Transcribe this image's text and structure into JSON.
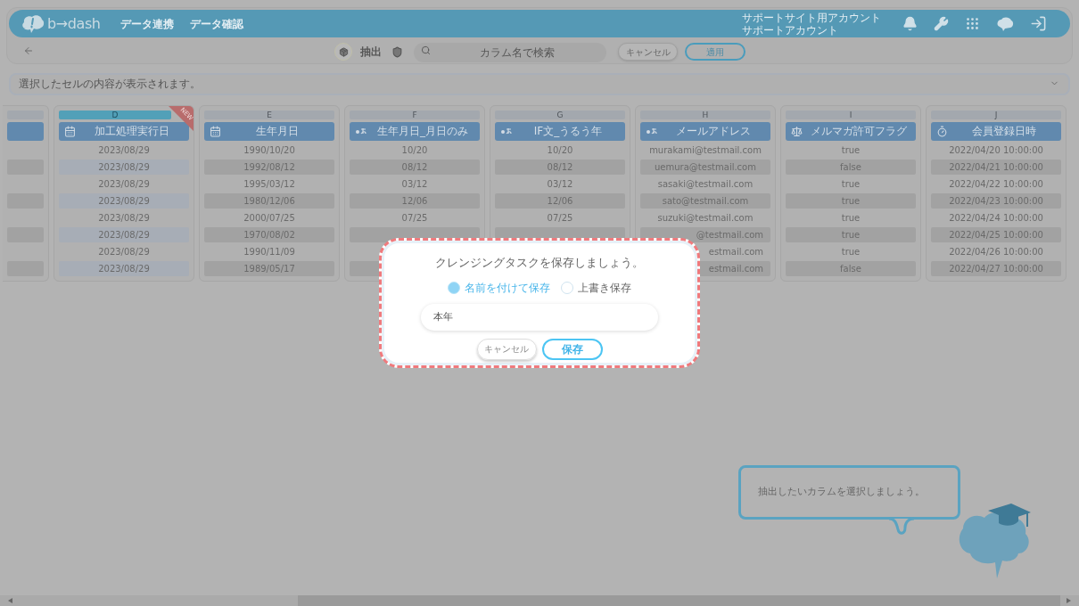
{
  "header": {
    "logo": "b→dash",
    "nav": [
      "データ連携",
      "データ確認"
    ],
    "account": [
      "サポートサイト用アカウント",
      "サポートアカウント"
    ]
  },
  "toolbar": {
    "title": "抽出",
    "search": {
      "placeholder": "カラム名で検索"
    },
    "buttons": [
      {
        "label": "キャンセル",
        "kind": "secondary"
      },
      {
        "label": "適用",
        "kind": "primary"
      }
    ]
  },
  "cell_viewer": {
    "placeholder": "選択したセルの内容が表示されます。"
  },
  "columns": [
    {
      "kind": "none",
      "selected": false,
      "cells": [
        null,
        null,
        null,
        null,
        null,
        null,
        null,
        null
      ]
    },
    {
      "letter": "D",
      "title": "加工処理実行日",
      "kind": "date",
      "selected": true,
      "badge": "NEW",
      "cells": [
        "2023/08/29",
        "2023/08/29",
        "2023/08/29",
        "2023/08/29",
        "2023/08/29",
        "2023/08/29",
        "2023/08/29",
        "2023/08/29"
      ]
    },
    {
      "letter": "E",
      "title": "生年月日",
      "kind": "date",
      "selected": false,
      "cells": [
        "1990/10/20",
        "1992/08/12",
        "1995/03/12",
        "1980/12/06",
        "2000/07/25",
        "1970/08/02",
        "1990/11/09",
        "1989/05/17"
      ]
    },
    {
      "letter": "F",
      "title": "生年月日_月日のみ",
      "kind": "text",
      "selected": false,
      "cells": [
        "10/20",
        "08/12",
        "03/12",
        "12/06",
        "07/25",
        null,
        null,
        null
      ]
    },
    {
      "letter": "G",
      "title": "IF文_うるう年",
      "kind": "text",
      "selected": false,
      "cells": [
        "10/20",
        "08/12",
        "03/12",
        "12/06",
        "07/25",
        null,
        null
      ]
    },
    {
      "letter": "H",
      "title": "メールアドレス",
      "kind": "text",
      "selected": false,
      "cells": [
        "murakami@testmail.com",
        "uemura@testmail.com",
        "sasaki@testmail.com",
        "sato@testmail.com",
        "suzuki@testmail.com",
        {
          "text": "@testmail.com",
          "clipped": true
        },
        {
          "text": "estmail.com",
          "clipped": true
        },
        {
          "text": "estmail.com",
          "clipped": true
        }
      ]
    },
    {
      "letter": "I",
      "title": "メルマガ許可フラグ",
      "kind": "bool",
      "selected": false,
      "cells": [
        "true",
        "false",
        "true",
        "true",
        "true",
        "true",
        "true",
        "false"
      ]
    },
    {
      "letter": "J",
      "title": "会員登録日時",
      "kind": "datetime",
      "selected": false,
      "cells": [
        "2022/04/20 10:00:00",
        "2022/04/21 10:00:00",
        "2022/04/22 10:00:00",
        "2022/04/23 10:00:00",
        "2022/04/24 10:00:00",
        "2022/04/25 10:00:00",
        "2022/04/26 10:00:00",
        "2022/04/27 10:00:00"
      ]
    }
  ],
  "dialog": {
    "title": "クレンジングタスクを保存しましょう。",
    "options": [
      {
        "label": "名前を付けて保存",
        "selected": true
      },
      {
        "label": "上書き保存",
        "selected": false
      }
    ],
    "name_value": "本年",
    "buttons": [
      {
        "label": "キャンセル",
        "kind": "secondary"
      },
      {
        "label": "保存",
        "kind": "primary"
      }
    ]
  },
  "hint_bubble": {
    "text": "抽出したいカラムを選択しましょう。"
  }
}
